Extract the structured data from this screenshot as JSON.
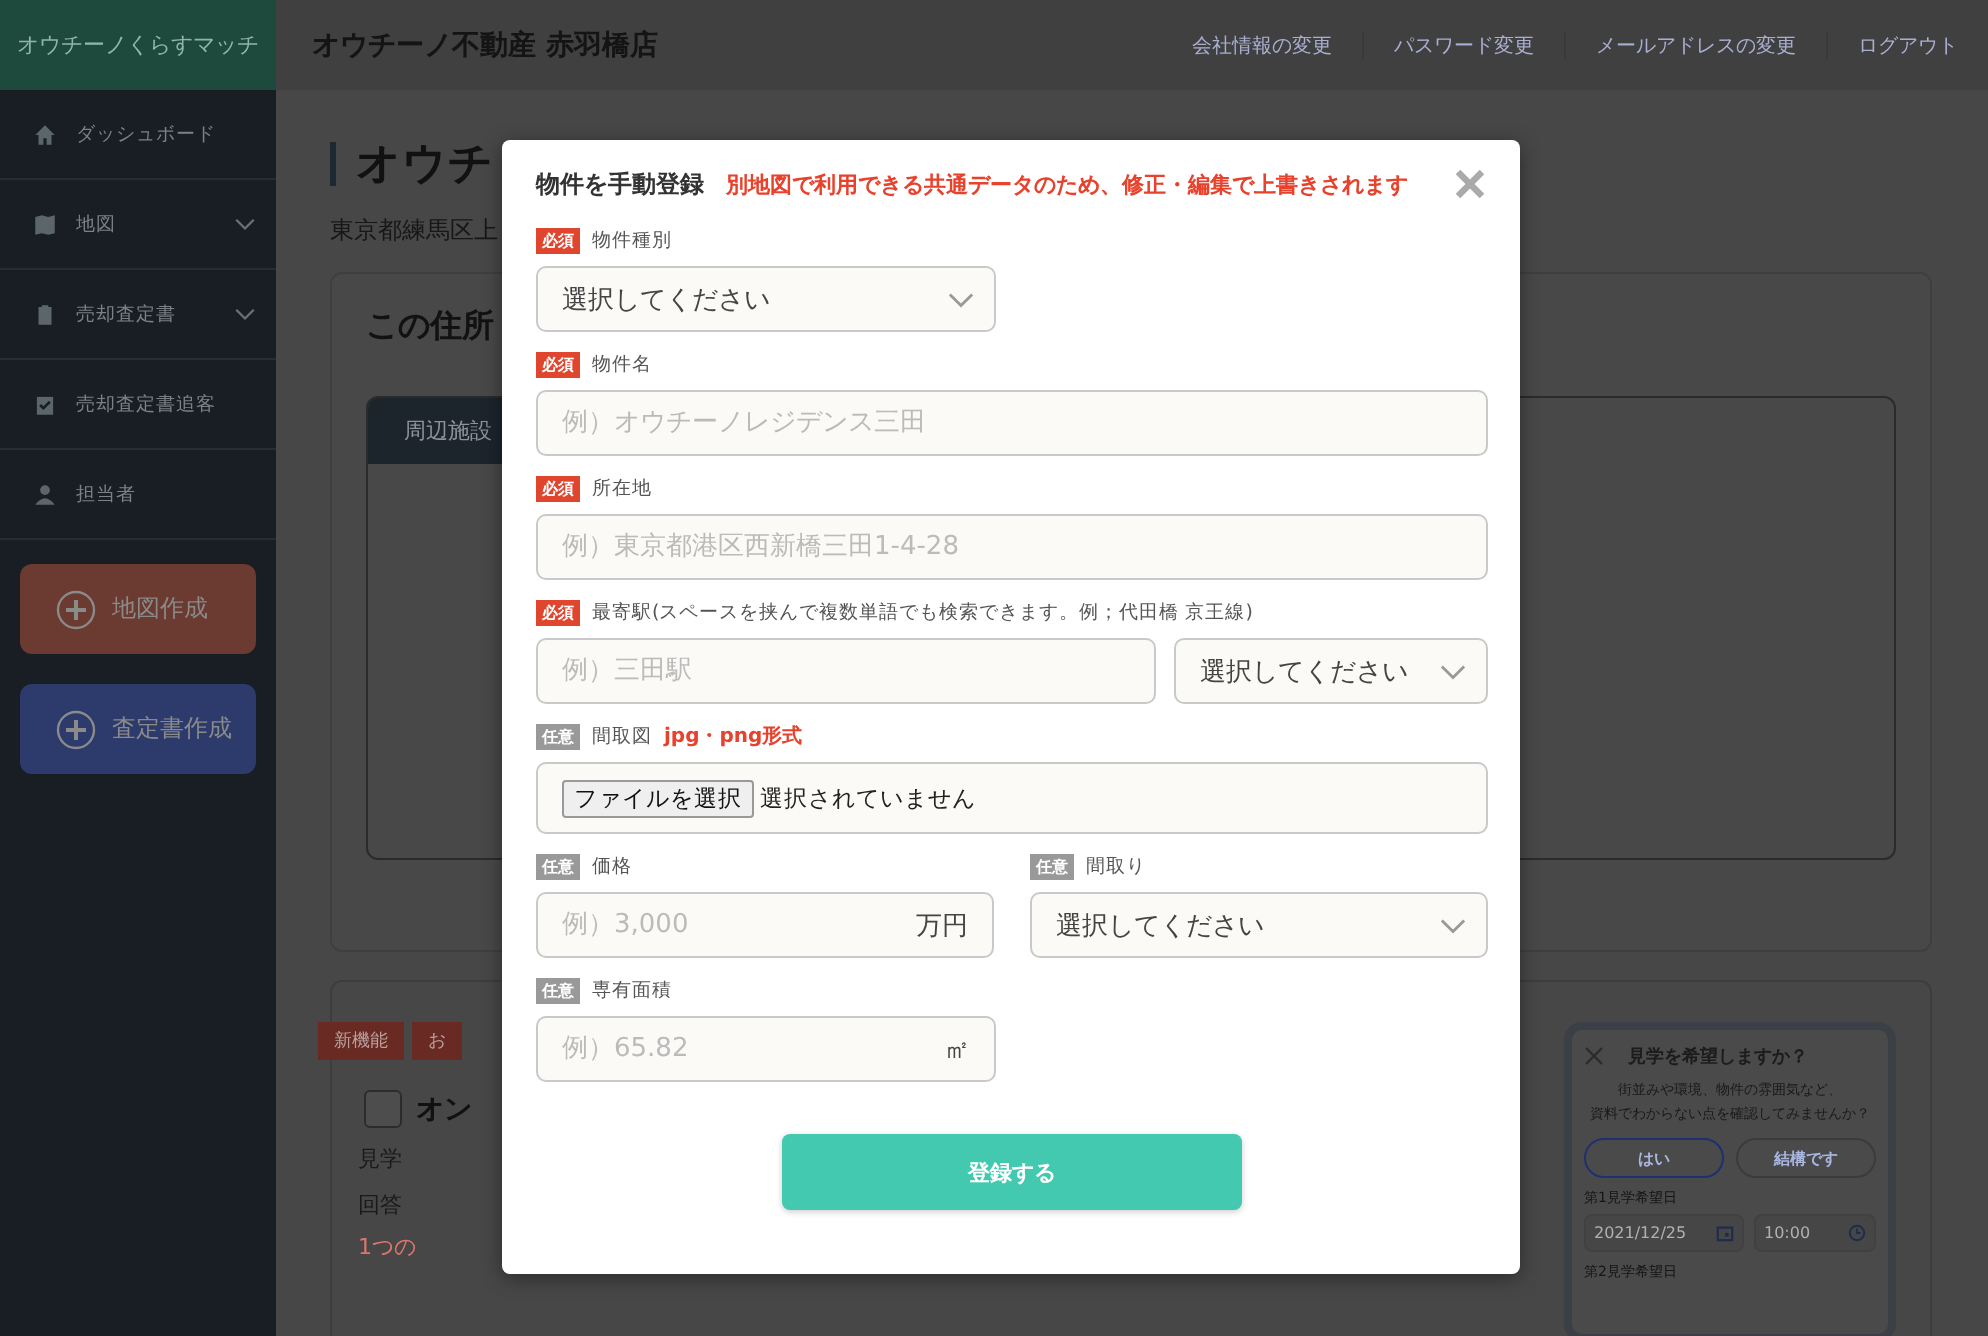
{
  "header": {
    "logo": "オウチーノくらすマッチ",
    "title": "オウチーノ不動産 赤羽橋店",
    "links": [
      "会社情報の変更",
      "パスワード変更",
      "メールアドレスの変更",
      "ログアウト"
    ]
  },
  "sidebar": {
    "items": [
      {
        "label": "ダッシュボード",
        "expandable": false
      },
      {
        "label": "地図",
        "expandable": true
      },
      {
        "label": "売却査定書",
        "expandable": true
      },
      {
        "label": "売却査定書追客",
        "expandable": false
      },
      {
        "label": "担当者",
        "expandable": false
      }
    ],
    "buttons": [
      {
        "label": "地図作成",
        "color": "#6b3a30"
      },
      {
        "label": "査定書作成",
        "color": "#2c3a6c"
      }
    ]
  },
  "page": {
    "title": "オウチ",
    "address": "東京都練馬区上",
    "card_title": "この住所",
    "tab": "周辺施設",
    "tags": [
      "新機能",
      "お"
    ],
    "checkbox": {
      "label": "オン",
      "checked": false
    },
    "lines": [
      "見学",
      "回答"
    ],
    "warning": "1つの",
    "visit_card": {
      "title": "見学を希望しますか？",
      "lines": [
        "街並みや環境、物件の雰囲気など、",
        "資料でわからない点を確認してみませんか？"
      ],
      "buttons": [
        {
          "label": "はい",
          "selected": true
        },
        {
          "label": "結構です",
          "selected": false
        }
      ],
      "date_label": "第1見学希望日",
      "date": "2021/12/25",
      "time": "10:00",
      "next_label": "第2見学希望日"
    }
  },
  "modal": {
    "title": "物件を手動登録",
    "note": "別地図で利用できる共通データのため、修正・編集で上書きされます",
    "rows": [
      [
        {
          "kind": "select",
          "badge": "必須",
          "required": true,
          "label": "物件種別",
          "value": "選択してください"
        }
      ],
      [
        {
          "kind": "text",
          "badge": "必須",
          "required": true,
          "label": "物件名",
          "placeholder": "例）オウチーノレジデンス三田"
        }
      ],
      [
        {
          "kind": "text",
          "badge": "必須",
          "required": true,
          "label": "所在地",
          "placeholder": "例）東京都港区西新橋三田1-4-28"
        }
      ],
      [
        {
          "kind": "text_select",
          "badge": "必須",
          "required": true,
          "label": "最寄駅(スペースを挟んで複数単語でも検索できます。例；代田橋 京王線)",
          "placeholder": "例）三田駅",
          "value": "選択してください"
        }
      ],
      [
        {
          "kind": "file",
          "badge": "任意",
          "required": false,
          "label": "間取図",
          "note": "jpg・png形式",
          "button": "ファイルを選択",
          "status": "選択されていません"
        }
      ],
      [
        {
          "kind": "unit",
          "badge": "任意",
          "required": false,
          "label": "価格",
          "placeholder": "例）3,000",
          "unit": "万円"
        },
        {
          "kind": "select",
          "badge": "任意",
          "required": false,
          "label": "間取り",
          "value": "選択してください"
        }
      ],
      [
        {
          "kind": "unit",
          "badge": "任意",
          "required": false,
          "label": "専有面積",
          "placeholder": "例）65.82",
          "unit": "㎡"
        }
      ]
    ],
    "submit": "登録する"
  }
}
